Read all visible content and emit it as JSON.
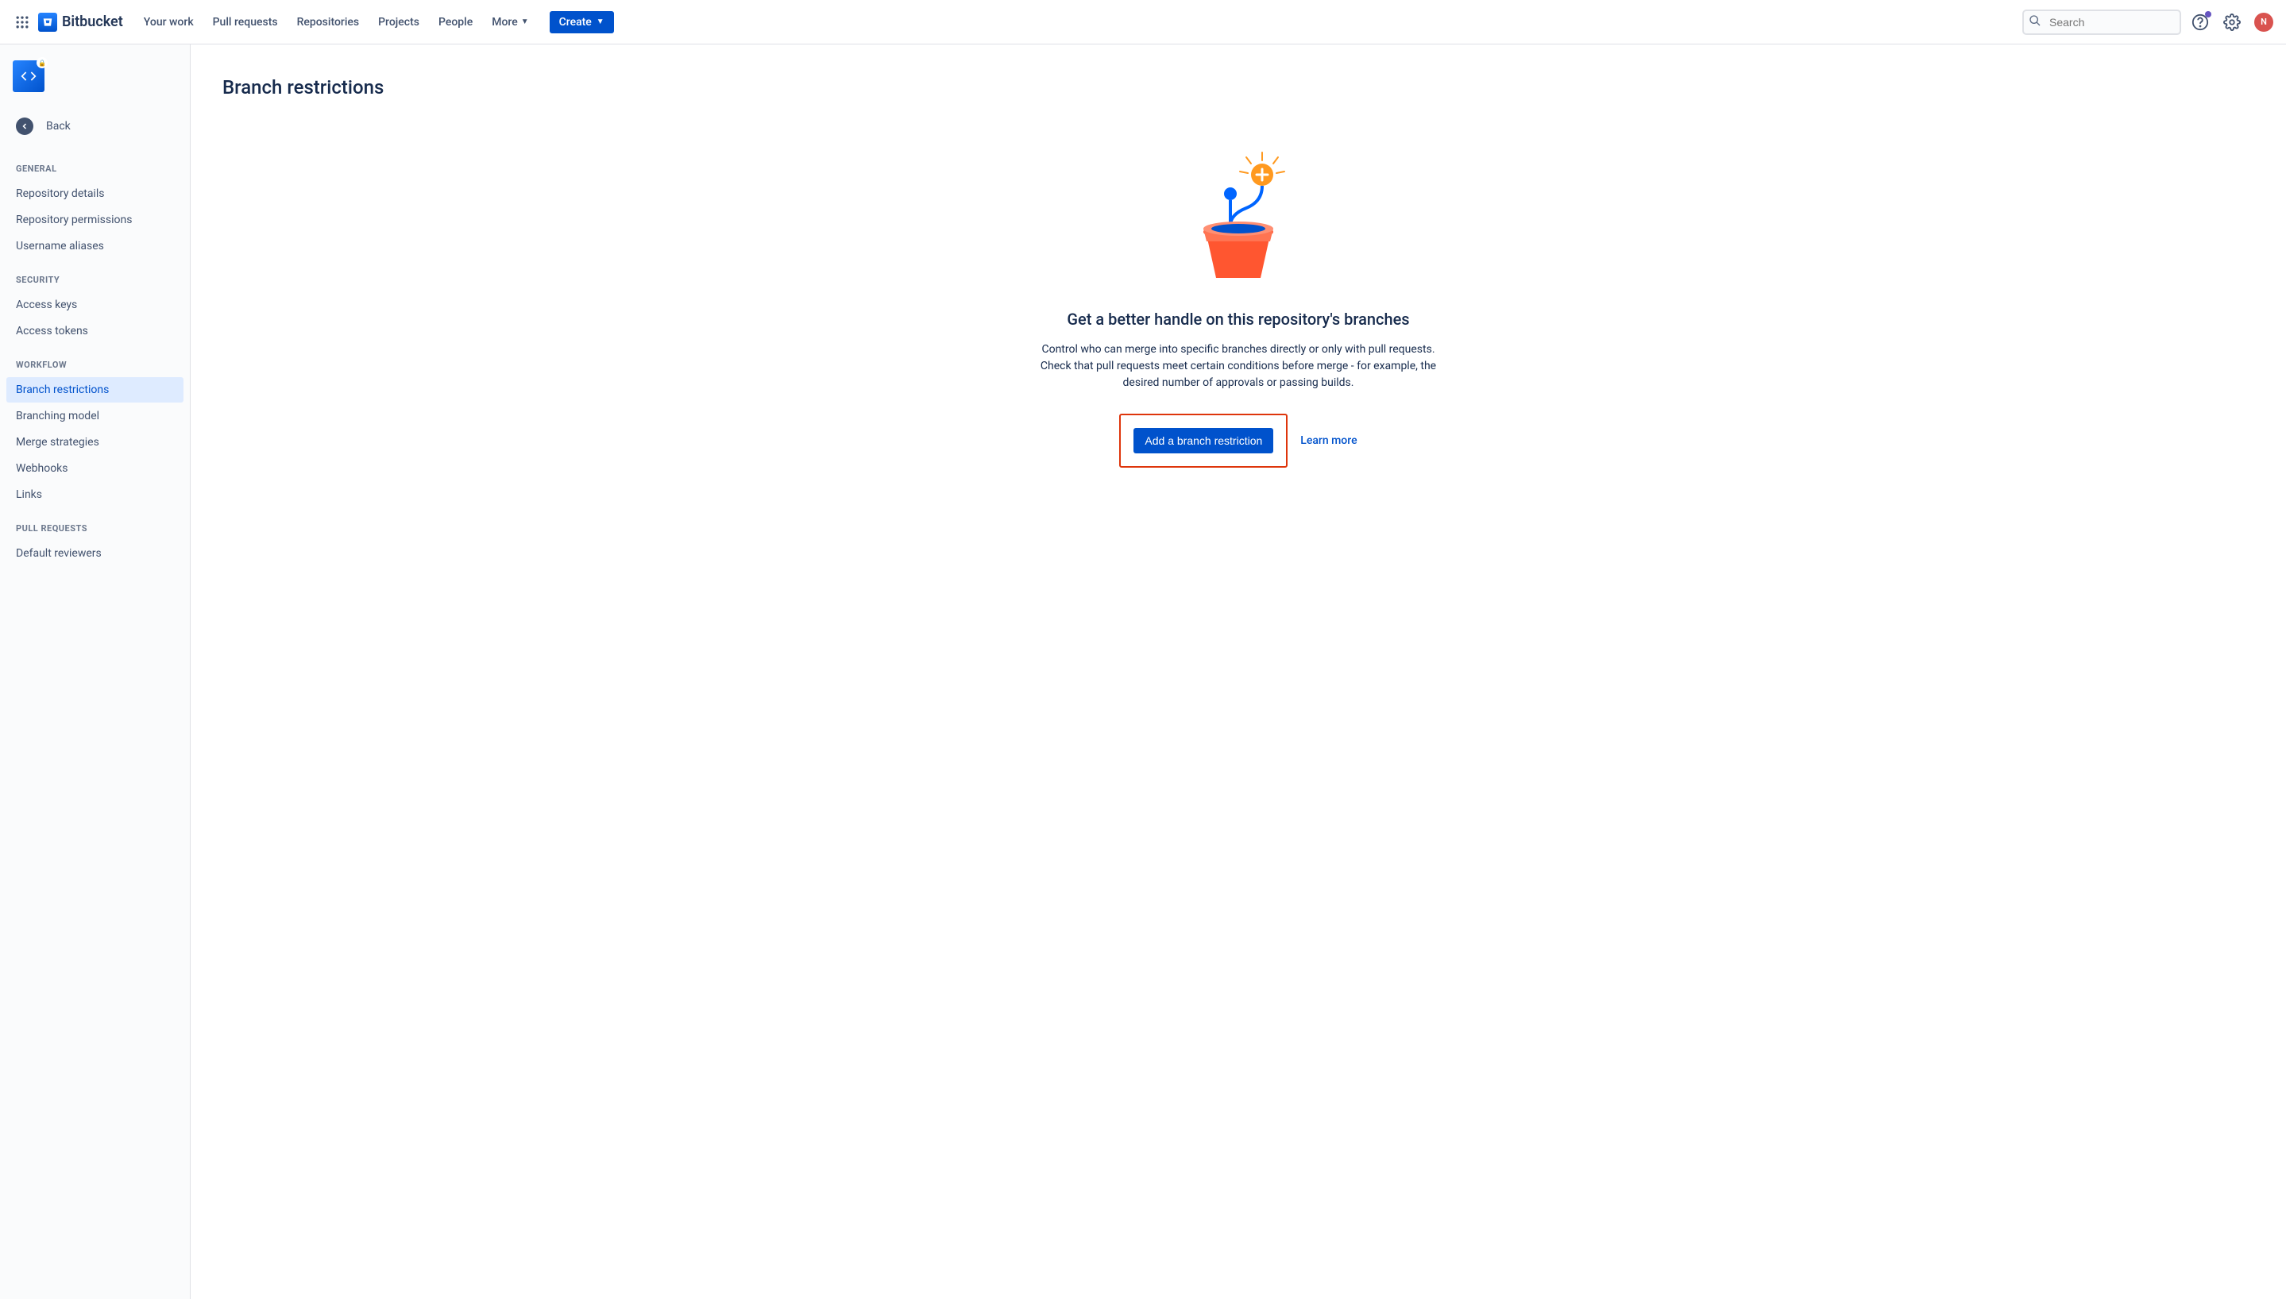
{
  "brand": "Bitbucket",
  "nav": {
    "your_work": "Your work",
    "pull_requests": "Pull requests",
    "repositories": "Repositories",
    "projects": "Projects",
    "people": "People",
    "more": "More",
    "create": "Create"
  },
  "search": {
    "placeholder": "Search"
  },
  "avatar_initials": "N",
  "sidebar": {
    "back": "Back",
    "sections": {
      "general": {
        "header": "General",
        "items": [
          "Repository details",
          "Repository permissions",
          "Username aliases"
        ]
      },
      "security": {
        "header": "Security",
        "items": [
          "Access keys",
          "Access tokens"
        ]
      },
      "workflow": {
        "header": "Workflow",
        "items": [
          "Branch restrictions",
          "Branching model",
          "Merge strategies",
          "Webhooks",
          "Links"
        ]
      },
      "pull_requests": {
        "header": "Pull Requests",
        "items": [
          "Default reviewers"
        ]
      }
    }
  },
  "page": {
    "title": "Branch restrictions",
    "empty": {
      "title": "Get a better handle on this repository's branches",
      "desc1": "Control who can merge into specific branches directly or only with pull requests.",
      "desc2": "Check that pull requests meet certain conditions before merge - for example, the desired number of approvals or passing builds.",
      "primary_cta": "Add a branch restriction",
      "secondary_cta": "Learn more"
    }
  }
}
